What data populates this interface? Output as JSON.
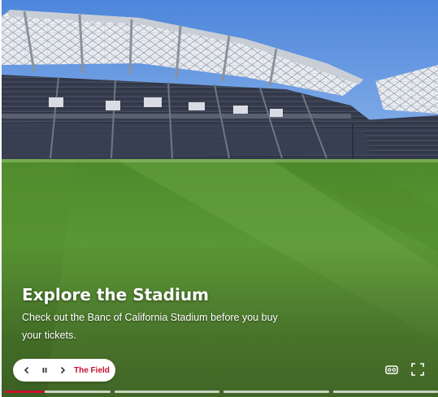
{
  "scene": {
    "title": "Explore the Stadium",
    "description": "Check out the Banc of California Stadium before you buy your tickets."
  },
  "controls": {
    "prev_icon": "chevron-left-icon",
    "pause_icon": "pause-icon",
    "next_icon": "chevron-right-icon",
    "current_scene_label": "The Field"
  },
  "tools": {
    "vr_icon": "vr-headset-icon",
    "fullscreen_icon": "fullscreen-icon"
  },
  "progress": {
    "segments": 4,
    "current_index": 0,
    "current_fraction": 0.38
  },
  "colors": {
    "accent": "#c8102e",
    "sky": "#3f7bd4",
    "grass": "#5f9a36"
  }
}
